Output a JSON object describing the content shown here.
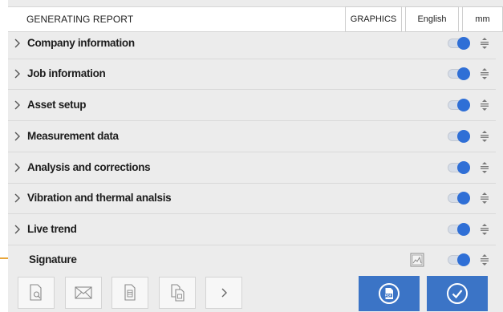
{
  "header": {
    "title": "GENERATING REPORT",
    "graphics_label": "GRAPHICS",
    "language_label": "English",
    "units_label": "mm"
  },
  "sections": [
    {
      "label": "Company information",
      "expandable": true,
      "enabled": true
    },
    {
      "label": "Job information",
      "expandable": true,
      "enabled": true
    },
    {
      "label": "Asset setup",
      "expandable": true,
      "enabled": true
    },
    {
      "label": "Measurement data",
      "expandable": true,
      "enabled": true
    },
    {
      "label": "Analysis and corrections",
      "expandable": true,
      "enabled": true
    },
    {
      "label": "Vibration and thermal analsis",
      "expandable": true,
      "enabled": true
    },
    {
      "label": "Live trend",
      "expandable": true,
      "enabled": true
    },
    {
      "label": "Signature",
      "expandable": false,
      "enabled": true
    }
  ],
  "toolbar": {
    "buttons": [
      "preview-icon",
      "email-icon",
      "document-icon",
      "copy-document-icon",
      "chevron-right-icon"
    ],
    "actions": [
      "pdf-icon",
      "check-circle-icon"
    ]
  },
  "colors": {
    "accent_blue": "#3b74c6",
    "toggle_knob": "#2f6fd6",
    "background": "#ececec"
  }
}
